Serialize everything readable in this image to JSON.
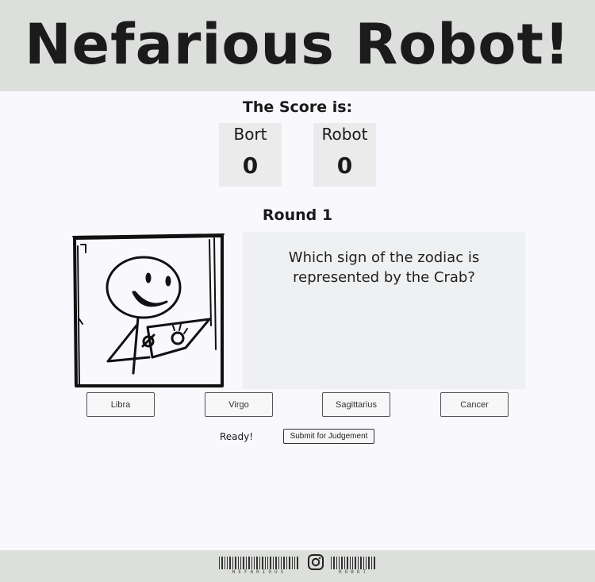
{
  "header": {
    "title": "Nefarious Robot!"
  },
  "score": {
    "heading": "The Score is:",
    "players": [
      {
        "name": "Bort",
        "value": "0"
      },
      {
        "name": "Robot",
        "value": "0"
      }
    ]
  },
  "round": {
    "label": "Round 1"
  },
  "question": {
    "text": "Which sign of the zodiac is represented by the Crab?"
  },
  "answers": [
    "Libra",
    "Virgo",
    "Sagittarius",
    "Cancer"
  ],
  "status": {
    "ready": "Ready!",
    "submit_label": "Submit for Judgement"
  },
  "footer": {
    "left_barcode_text": "NEFARIOUS",
    "right_barcode_text": "ROBOT",
    "social_icon": "instagram-icon"
  },
  "colors": {
    "background": "#f8f8fd",
    "header_bg": "#dcdfdb",
    "panel_bg": "#eff0f1",
    "score_bg": "#ebebeb"
  }
}
